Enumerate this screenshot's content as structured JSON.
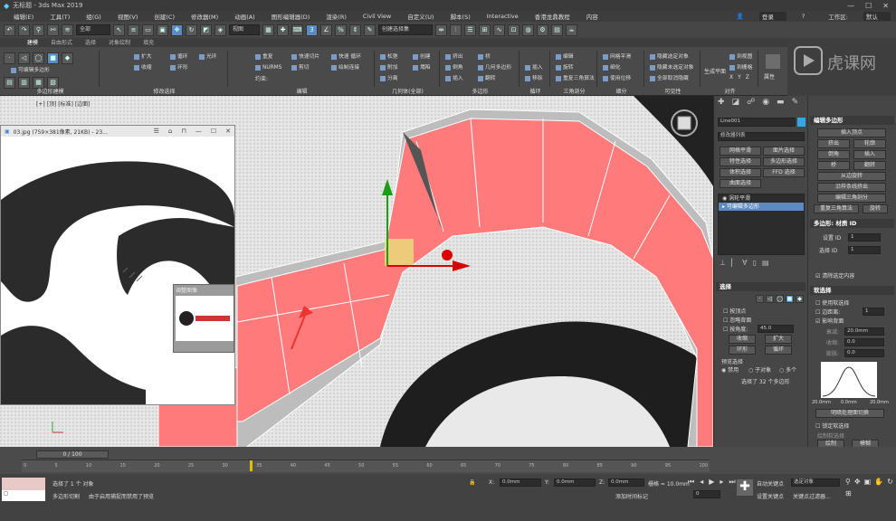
{
  "app": {
    "title": "无标题 - 3ds Max 2019",
    "window_controls": [
      "—",
      "☐",
      "✕"
    ]
  },
  "menubar": {
    "items": [
      "编辑(E)",
      "工具(T)",
      "组(G)",
      "视图(V)",
      "创建(C)",
      "修改器(M)",
      "动画(A)",
      "图形编辑器(D)",
      "渲染(R)",
      "Civil View",
      "自定义(U)",
      "脚本(S)",
      "Interactive",
      "香港龙鼎教程",
      "内容"
    ],
    "signin": "登录",
    "workspace_label": "工作区:",
    "workspace_value": "默认"
  },
  "toolbar": {
    "filter": "全部",
    "view": "视图",
    "selection_set": "创建选择集"
  },
  "ribbon_tabs": [
    "建模",
    "自由形式",
    "选择",
    "对象绘制",
    "填充"
  ],
  "ribbon": {
    "g1": {
      "label": "多边形建模",
      "item": "可编辑多边形"
    },
    "g2": {
      "label": "修改选择",
      "items": [
        "扩大",
        "收缩",
        "循环",
        "环形",
        "光环"
      ]
    },
    "g3": {
      "label": "编辑",
      "items": [
        "重复",
        "快速切片",
        "快速 循环",
        "NURMS",
        "剪切",
        "绘制连接"
      ],
      "constraint": "约束:"
    },
    "g4": {
      "label": "几何体(全部)",
      "items": [
        "松弛",
        "创建",
        "附加",
        "塌陷",
        "分离"
      ]
    },
    "g5": {
      "label": "多边形",
      "items": [
        "挤出",
        "倒角",
        "插入",
        "桥",
        "几何多边形",
        "翻转"
      ]
    },
    "g6": {
      "label": "循环",
      "items": [
        "插入",
        "移除"
      ]
    },
    "g7": {
      "label": "三角剖分",
      "items": [
        "编辑",
        "旋转",
        "重复三角算法"
      ]
    },
    "g8": {
      "label": "细分",
      "items": [
        "网格平滑",
        "细化",
        "使用位移"
      ]
    },
    "g9": {
      "label": "可见性",
      "items": [
        "隐藏选定对象",
        "隐藏未选定对象",
        "全部取消隐藏"
      ]
    },
    "g10": {
      "label": "对齐",
      "items": [
        "生成平面",
        "到视图",
        "到栅格",
        "X",
        "Y",
        "Z"
      ]
    },
    "g11": {
      "label": "属性"
    }
  },
  "viewport": {
    "label": "[+] [顶] [标准] [边面]"
  },
  "image_window": {
    "title": "03.jpg (759×381像素, 21KB) - 23..."
  },
  "thumb_window": {
    "title": "调整图像"
  },
  "command_panel": {
    "object_name": "Line001",
    "modifier_list": "修改器列表",
    "buttons": [
      "网格平滑",
      "面片选择",
      "特性选择",
      "多边形选择",
      "体积选择",
      "FFD 选择",
      "曲面选择"
    ],
    "stack": [
      "涡轮平滑",
      "可编辑多边形"
    ],
    "select_title": "选择",
    "by_vertex": "按顶点",
    "ignore_back": "忽略背面",
    "by_angle": "按角度:",
    "angle": "45.0",
    "shrink": "收缩",
    "grow": "扩大",
    "ring": "环形",
    "loop": "循环",
    "preview": "预览选择",
    "preview_options": [
      "禁用",
      "子对象",
      "多个"
    ],
    "status": "选择了 32 个多边形"
  },
  "modifier_panel": {
    "edit_poly": "编辑多边形",
    "insert_vertex": "插入顶点",
    "extrude": "挤出",
    "outline": "轮廓",
    "bevel": "倒角",
    "inset": "插入",
    "bridge": "桥",
    "flip": "翻转",
    "hinge": "从边旋转",
    "extrude_spline": "沿样条线挤出",
    "edit_tri": "编辑三角剖分",
    "retri": "重复三角算法",
    "turn": "旋转",
    "mat_title": "多边形: 材质 ID",
    "set_id": "设置 ID",
    "set_id_val": "1",
    "select_id": "选择 ID",
    "select_id_val": "1",
    "clear_sel": "清除选定内容",
    "soft_title": "软选择",
    "use_soft": "使用软选择",
    "edge_dist": "边距离:",
    "edge_dist_val": "1",
    "affect_back": "影响背面",
    "falloff": "衰减:",
    "falloff_val": "20.0mm",
    "pinch": "收缩:",
    "pinch_val": "0.0",
    "bubble": "膨胀:",
    "bubble_val": "0.0",
    "curve_labels": [
      "20.0mm",
      "0.0mm",
      "20.0mm"
    ],
    "shaded": "明暗处理面切换",
    "lock": "锁定软选择",
    "paint_title": "绘制软选择",
    "paint": "绘制",
    "blur": "模糊"
  },
  "timeline": {
    "frame": "0 / 100",
    "ticks": [
      "0",
      "5",
      "10",
      "15",
      "20",
      "25",
      "30",
      "35",
      "40",
      "45",
      "50",
      "55",
      "60",
      "65",
      "70",
      "75",
      "80",
      "85",
      "90",
      "95",
      "100"
    ]
  },
  "status": {
    "line1": "选择了 1 个 对象",
    "line2": "多边形切割",
    "line3": "由于启用捕捉而禁用了预览",
    "x": "0.0mm",
    "y": "0.0mm",
    "z": "0.0mm",
    "grid": "栅格 = 10.0mm",
    "add_time": "添加时间标记",
    "autokey": "自动关键点",
    "selected": "选定对象",
    "setkey": "设置关键点",
    "key_filter": "关键点过滤器...",
    "frame": "0"
  }
}
